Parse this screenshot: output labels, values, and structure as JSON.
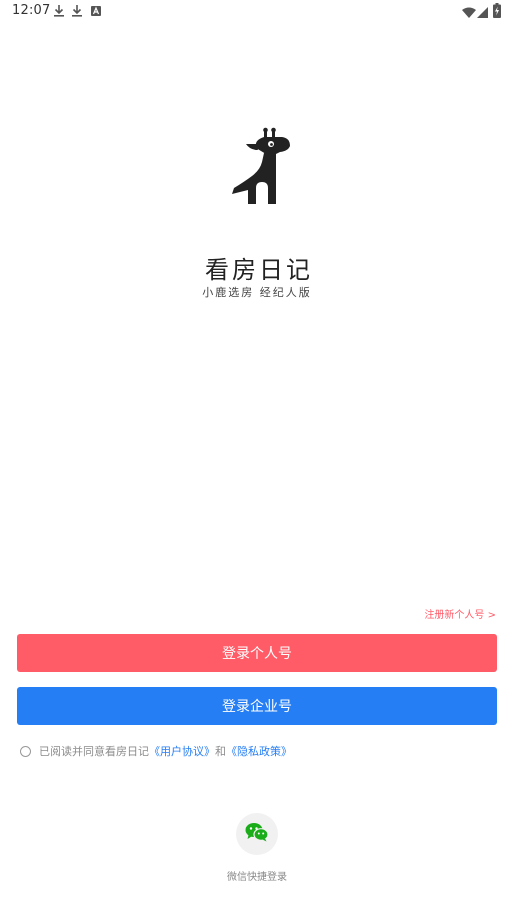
{
  "status_bar": {
    "time": "12:07",
    "notification_icons": [
      "download-icon",
      "download-icon",
      "font-icon"
    ],
    "right_icons": [
      "wifi-icon",
      "signal-icon",
      "battery-charging-icon"
    ]
  },
  "branding": {
    "logo_icon": "giraffe-icon",
    "title": "看房日记",
    "subtitle": "小鹿选房  经纪人版"
  },
  "actions": {
    "register_link": "注册新个人号 >",
    "login_personal": "登录个人号",
    "login_enterprise": "登录企业号"
  },
  "agreement": {
    "prefix": "已阅读并同意看房日记",
    "user_agreement": "《用户协议》",
    "and": "和",
    "privacy_policy": "《隐私政策》",
    "checked": false
  },
  "wechat": {
    "icon": "wechat-icon",
    "label": "微信快捷登录"
  },
  "colors": {
    "primary_red": "#ff5c68",
    "primary_blue": "#267ef5",
    "wechat_green": "#1aad19"
  }
}
